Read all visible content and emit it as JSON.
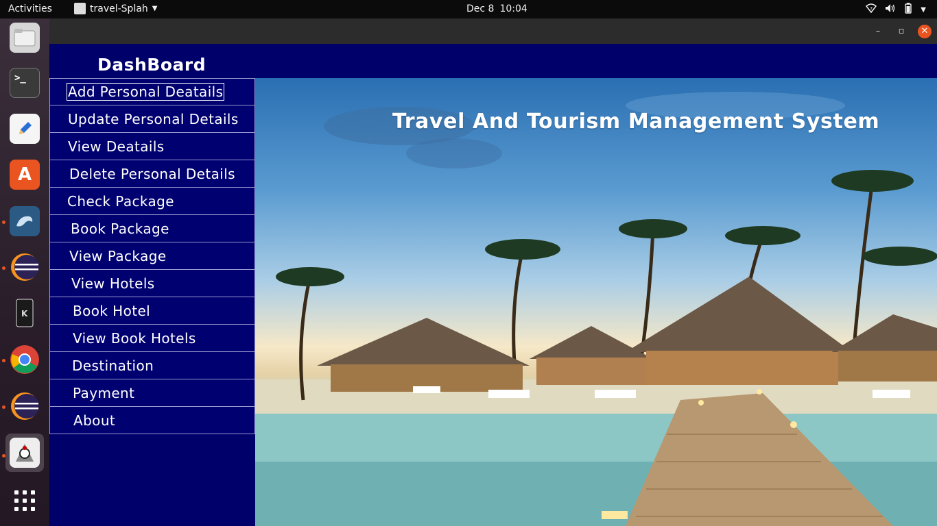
{
  "topbar": {
    "activities": "Activities",
    "app_name": "travel-Splah",
    "date": "Dec 8",
    "time": "10:04"
  },
  "dock": {
    "items": [
      {
        "name": "files",
        "icon": "folder-icon",
        "color": "#cfcfcf"
      },
      {
        "name": "terminal",
        "icon": "terminal-icon",
        "color": "#2e2e2e"
      },
      {
        "name": "text-editor",
        "icon": "pencil-icon",
        "color": "#f5f5f5"
      },
      {
        "name": "software",
        "icon": "store-icon",
        "color": "#e95420"
      },
      {
        "name": "mysql-workbench",
        "icon": "dolphin-icon",
        "color": "#2b5b84"
      },
      {
        "name": "eclipse",
        "icon": "eclipse-icon",
        "color": "#2c2255"
      },
      {
        "name": "kde-connect",
        "icon": "phone-icon",
        "color": "#222"
      },
      {
        "name": "chrome",
        "icon": "chrome-icon",
        "color": "#dd4b39"
      },
      {
        "name": "eclipse-2",
        "icon": "eclipse-icon",
        "color": "#2c2255"
      },
      {
        "name": "java",
        "icon": "java-icon",
        "color": "#eeeeee"
      },
      {
        "name": "show-apps",
        "icon": "grid-icon",
        "color": "transparent"
      }
    ]
  },
  "window": {
    "controls": {
      "minimize": "–",
      "maximize": "▫",
      "close": "✕"
    }
  },
  "dashboard": {
    "title": "DashBoard",
    "menu": [
      "Add Personal Deatails",
      "Update Personal Details",
      "View Deatails",
      "Delete Personal Details",
      "Check Package",
      "Book Package",
      "View Package",
      "View Hotels",
      "Book Hotel",
      "View Book Hotels",
      "Destination",
      "Payment",
      "About"
    ]
  },
  "main": {
    "title": "Travel And Tourism Management System"
  },
  "colors": {
    "dashboard_bg": "#00006b",
    "accent": "#e95420"
  }
}
